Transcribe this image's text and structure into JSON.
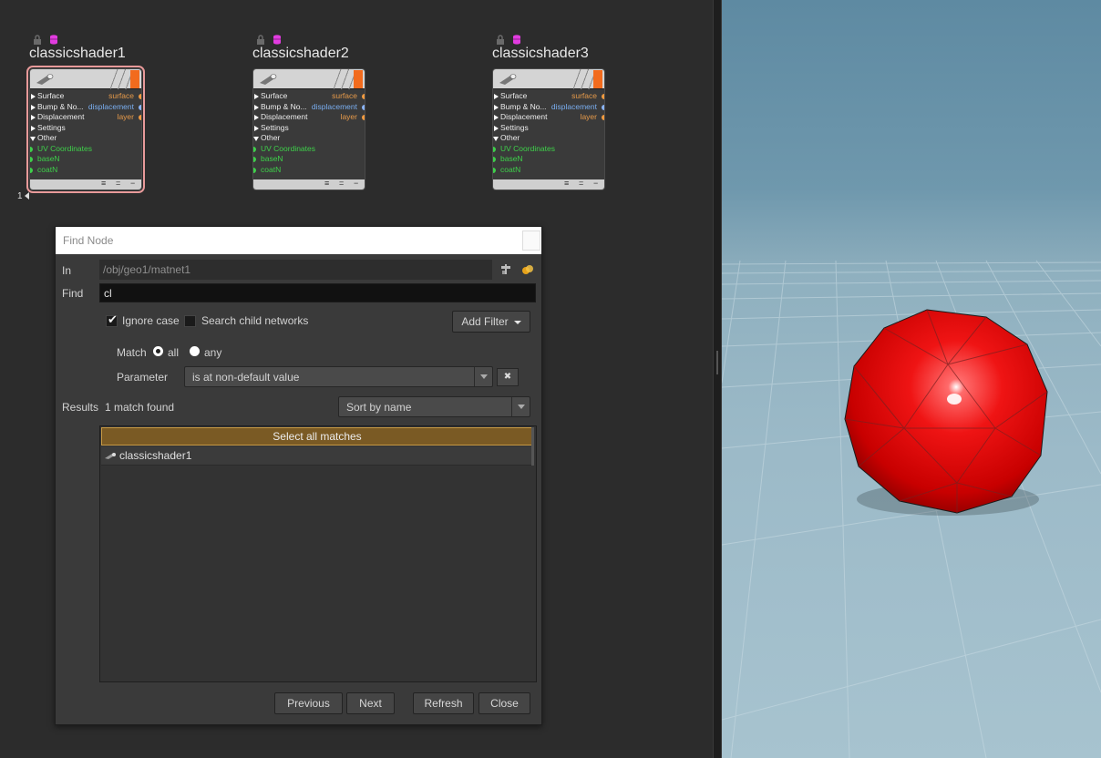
{
  "nodes": [
    {
      "id": 1,
      "title": "classicshader1",
      "selected": true,
      "index_label": "1",
      "inputs": [
        {
          "label": "Surface",
          "type": "collapsed",
          "output": "surface",
          "out_color": "orange"
        },
        {
          "label": "Bump & No...",
          "type": "collapsed",
          "output": "displacement",
          "out_color": "blue"
        },
        {
          "label": "Displacement",
          "type": "collapsed",
          "output": "layer",
          "out_color": "orange"
        },
        {
          "label": "Settings",
          "type": "collapsed",
          "output": "",
          "out_color": ""
        },
        {
          "label": "Other",
          "type": "expanded",
          "output": "",
          "out_color": ""
        },
        {
          "label": "UV Coordinates",
          "type": "port",
          "output": "",
          "out_color": ""
        },
        {
          "label": "baseN",
          "type": "port",
          "output": "",
          "out_color": ""
        },
        {
          "label": "coatN",
          "type": "port",
          "output": "",
          "out_color": ""
        }
      ],
      "footer_glyphs": [
        "≡",
        "=",
        "−"
      ]
    },
    {
      "id": 2,
      "title": "classicshader2",
      "selected": false,
      "inputs": [
        {
          "label": "Surface",
          "type": "collapsed",
          "output": "surface",
          "out_color": "orange"
        },
        {
          "label": "Bump & No...",
          "type": "collapsed",
          "output": "displacement",
          "out_color": "blue"
        },
        {
          "label": "Displacement",
          "type": "collapsed",
          "output": "layer",
          "out_color": "orange"
        },
        {
          "label": "Settings",
          "type": "collapsed",
          "output": "",
          "out_color": ""
        },
        {
          "label": "Other",
          "type": "expanded",
          "output": "",
          "out_color": ""
        },
        {
          "label": "UV Coordinates",
          "type": "port",
          "output": "",
          "out_color": ""
        },
        {
          "label": "baseN",
          "type": "port",
          "output": "",
          "out_color": ""
        },
        {
          "label": "coatN",
          "type": "port",
          "output": "",
          "out_color": ""
        }
      ],
      "footer_glyphs": [
        "≡",
        "=",
        "−"
      ]
    },
    {
      "id": 3,
      "title": "classicshader3",
      "selected": false,
      "inputs": [
        {
          "label": "Surface",
          "type": "collapsed",
          "output": "surface",
          "out_color": "orange"
        },
        {
          "label": "Bump & No...",
          "type": "collapsed",
          "output": "displacement",
          "out_color": "blue"
        },
        {
          "label": "Displacement",
          "type": "collapsed",
          "output": "layer",
          "out_color": "orange"
        },
        {
          "label": "Settings",
          "type": "collapsed",
          "output": "",
          "out_color": ""
        },
        {
          "label": "Other",
          "type": "expanded",
          "output": "",
          "out_color": ""
        },
        {
          "label": "UV Coordinates",
          "type": "port",
          "output": "",
          "out_color": ""
        },
        {
          "label": "baseN",
          "type": "port",
          "output": "",
          "out_color": ""
        },
        {
          "label": "coatN",
          "type": "port",
          "output": "",
          "out_color": ""
        }
      ],
      "footer_glyphs": [
        "≡",
        "=",
        "−"
      ]
    }
  ],
  "node_colors": {
    "accent_flag": "#f26b1d",
    "port_green": "#3ed04a",
    "out_orange": "#f09a40",
    "out_blue": "#8ab4f8",
    "selected_outline": "#e89a9a"
  },
  "dialog": {
    "title": "Find Node",
    "in_label": "In",
    "in_value": "/obj/geo1/matnet1",
    "find_label": "Find",
    "find_value": "cl",
    "ignore_case_label": "Ignore case",
    "ignore_case_checked": true,
    "search_child_label": "Search child networks",
    "search_child_checked": false,
    "add_filter_label": "Add Filter",
    "match_label": "Match",
    "match_all_label": "all",
    "match_any_label": "any",
    "match_selected": "all",
    "parameter_label": "Parameter",
    "parameter_value": "is at non-default value",
    "results_label": "Results",
    "results_count_text": "1 match found",
    "sort_value": "Sort by name",
    "select_all_label": "Select all matches",
    "results": [
      "classicshader1"
    ],
    "buttons": {
      "previous": "Previous",
      "next": "Next",
      "refresh": "Refresh",
      "close": "Close"
    },
    "icons": [
      "pin-icon",
      "network-jump-icon"
    ]
  }
}
